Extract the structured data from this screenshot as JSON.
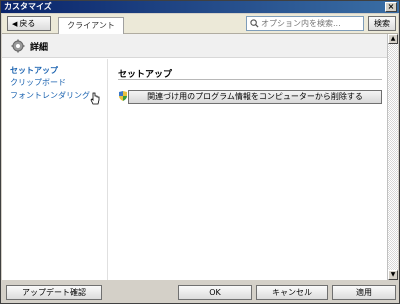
{
  "window": {
    "title": "カスタマイズ",
    "close_label": "×"
  },
  "toolbar": {
    "back_label": "戻る",
    "tab_label": "クライアント",
    "search_placeholder": "オプション内を検索...",
    "search_button_label": "検索"
  },
  "header": {
    "title": "詳細"
  },
  "sidebar": {
    "items": [
      {
        "label": "セットアップ"
      },
      {
        "label": "クリップボード"
      },
      {
        "label": "フォントレンダリング"
      }
    ]
  },
  "main": {
    "section_title": "セットアップ",
    "remove_button_label": "関連づけ用のプログラム情報をコンピューターから削除する"
  },
  "footer": {
    "update_label": "アップデート確認",
    "ok_label": "OK",
    "cancel_label": "キャンセル",
    "apply_label": "適用"
  },
  "colors": {
    "accent": "#1a62b0",
    "titlebar": "#0a246a"
  }
}
